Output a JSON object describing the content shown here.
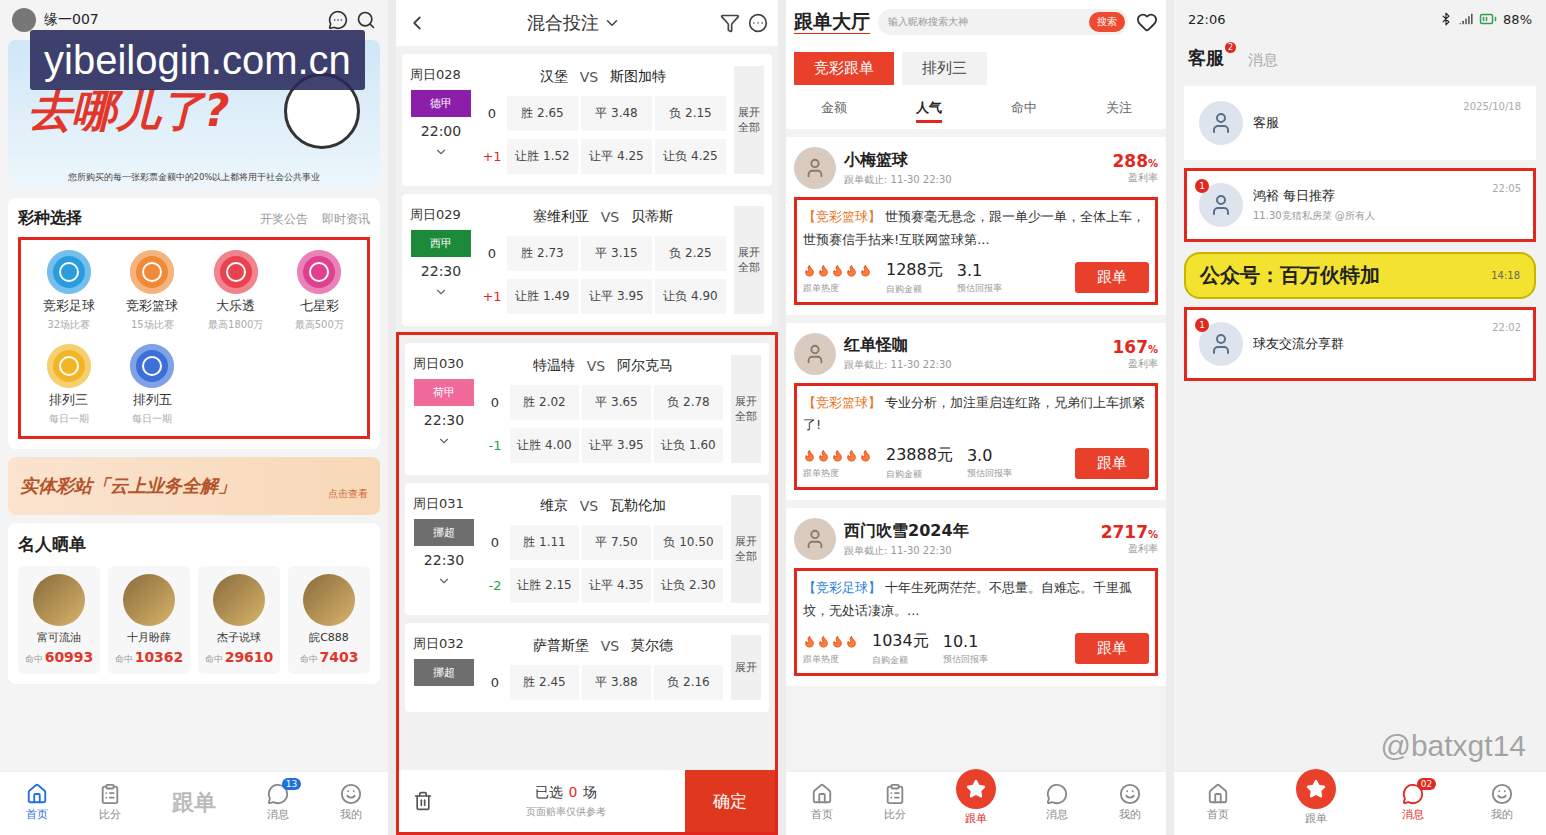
{
  "watermark": "yibeilogin.com.cn",
  "home": {
    "user": "缘一007",
    "banner": {
      "headline": "去哪儿了?",
      "note": "您所购买的每一张彩票金额中的20%以上都将用于社会公共事业"
    },
    "section": {
      "title": "彩种选择",
      "links": [
        "开奖公告",
        "即时资讯"
      ]
    },
    "games": {
      "highlighted": true,
      "items": [
        {
          "name": "竞彩足球",
          "sub": "32场比赛",
          "color": "#2a9de0"
        },
        {
          "name": "竞彩篮球",
          "sub": "15场比赛",
          "color": "#f08a3a"
        },
        {
          "name": "大乐透",
          "sub": "最高1800万",
          "color": "#e8434f"
        },
        {
          "name": "七星彩",
          "sub": "最高500万",
          "color": "#e0408f"
        },
        {
          "name": "排列三",
          "sub": "每日一期",
          "color": "#f2b526"
        },
        {
          "name": "排列五",
          "sub": "每日一期",
          "color": "#3c6fd8"
        }
      ]
    },
    "promo": {
      "title": "实体彩站「云上业务全解」",
      "link": "点击查看"
    },
    "stars": {
      "title": "名人晒单",
      "items": [
        {
          "name": "富可流油",
          "label": "命中",
          "value": "60993"
        },
        {
          "name": "十月盼薛",
          "label": "命中",
          "value": "10362"
        },
        {
          "name": "杰子说球",
          "label": "命中",
          "value": "29610"
        },
        {
          "name": "皖C888",
          "label": "命中",
          "value": "7403"
        }
      ]
    },
    "nav": [
      {
        "label": "首页",
        "selected": true,
        "kind": "icon",
        "badge": ""
      },
      {
        "label": "比分",
        "selected": false,
        "kind": "icon",
        "badge": ""
      },
      {
        "label": "跟单",
        "selected": false,
        "kind": "text",
        "badge": ""
      },
      {
        "label": "消息",
        "selected": false,
        "kind": "icon",
        "badge": "13"
      },
      {
        "label": "我的",
        "selected": false,
        "kind": "icon",
        "badge": ""
      }
    ]
  },
  "betting": {
    "title": "混合投注",
    "matches": [
      {
        "no": "周日028",
        "league": "德甲",
        "color": "#8b1fa9",
        "time": "22:00",
        "home": "汉堡",
        "vs": "VS",
        "away": "斯图加特",
        "base": "0",
        "odds": [
          "胜 2.65",
          "平 3.48",
          "负 2.15"
        ],
        "handicap": "+1",
        "hodds": [
          "让胜 1.52",
          "让平 4.25",
          "让负 4.25"
        ],
        "expand": "展开全部",
        "highlighted": false
      },
      {
        "no": "周日029",
        "league": "西甲",
        "color": "#1d8a3a",
        "time": "22:30",
        "home": "塞维利亚",
        "vs": "VS",
        "away": "贝蒂斯",
        "base": "0",
        "odds": [
          "胜 2.73",
          "平 3.15",
          "负 2.25"
        ],
        "handicap": "+1",
        "hodds": [
          "让胜 1.49",
          "让平 3.95",
          "让负 4.90"
        ],
        "expand": "展开全部",
        "highlighted": false
      },
      {
        "no": "周日030",
        "league": "荷甲",
        "color": "#f06a9a",
        "time": "22:30",
        "home": "特温特",
        "vs": "VS",
        "away": "阿尔克马",
        "base": "0",
        "odds": [
          "胜 2.02",
          "平 3.65",
          "负 2.78"
        ],
        "handicap": "-1",
        "hodds": [
          "让胜 4.00",
          "让平 3.95",
          "让负 1.60"
        ],
        "expand": "展开全部",
        "highlighted": true
      },
      {
        "no": "周日031",
        "league": "挪超",
        "color": "#6e6e6e",
        "time": "22:30",
        "home": "维京",
        "vs": "VS",
        "away": "瓦勒伦加",
        "base": "0",
        "odds": [
          "胜 1.11",
          "平 7.50",
          "负 10.50"
        ],
        "handicap": "-2",
        "hodds": [
          "让胜 2.15",
          "让平 4.35",
          "让负 2.30"
        ],
        "expand": "展开全部",
        "highlighted": true
      },
      {
        "no": "周日032",
        "league": "挪超",
        "color": "#6e6e6e",
        "time": "",
        "home": "萨普斯堡",
        "vs": "VS",
        "away": "莫尔德",
        "base": "0",
        "odds": [
          "胜 2.45",
          "平 3.88",
          "负 2.16"
        ],
        "handicap": "",
        "hodds": [],
        "expand": "展开",
        "highlighted": true
      }
    ],
    "footer": {
      "prefix": "已选",
      "count": "0",
      "suffix": "场",
      "note": "页面赔率仅供参考",
      "button": "确定",
      "highlighted": true
    }
  },
  "follow": {
    "title": "跟单大厅",
    "search": {
      "placeholder": "输入昵称搜索大神",
      "button": "搜索"
    },
    "tabs": [
      {
        "label": "竞彩跟单",
        "selected": true
      },
      {
        "label": "排列三",
        "selected": false
      }
    ],
    "sorts": [
      {
        "label": "金额",
        "selected": false
      },
      {
        "label": "人气",
        "selected": true
      },
      {
        "label": "命中",
        "selected": false
      },
      {
        "label": "关注",
        "selected": false
      }
    ],
    "cards": [
      {
        "name": "小梅篮球",
        "deadline": "跟单截止: 11-30 22:30",
        "rate": "288",
        "unit": "%",
        "rate_label": "盈利率",
        "tag": "【竞彩篮球】",
        "color": "#e8731c",
        "text": "世预赛毫无悬念，跟一单少一单，全体上车，世预赛信手拈来!互联网篮球第...",
        "stars": 5,
        "heat_label": "跟单热度",
        "amount": "1288元",
        "amount_label": "自购金额",
        "ret": "3.1",
        "ret_label": "预估回报率",
        "button": "跟单",
        "highlighted": true
      },
      {
        "name": "红单怪咖",
        "deadline": "跟单截止: 11-30 22:30",
        "rate": "167",
        "unit": "%",
        "rate_label": "盈利率",
        "tag": "【竞彩篮球】",
        "color": "#e8731c",
        "text": "专业分析，加注重启连红路，兄弟们上车抓紧了!",
        "stars": 5,
        "heat_label": "跟单热度",
        "amount": "23888元",
        "amount_label": "自购金额",
        "ret": "3.0",
        "ret_label": "预估回报率",
        "button": "跟单",
        "highlighted": true
      },
      {
        "name": "西门吹雪2024年",
        "deadline": "跟单截止: 11-30 22:30",
        "rate": "2717",
        "unit": "%",
        "rate_label": "盈利率",
        "tag": "【竞彩足球】",
        "color": "#2a7fd8",
        "text": "十年生死两茫茫。不思量。自难忘。千里孤坟，无处话凄凉。...",
        "stars": 4,
        "heat_label": "跟单热度",
        "amount": "1034元",
        "amount_label": "自购金额",
        "ret": "10.1",
        "ret_label": "预估回报率",
        "button": "跟单",
        "highlighted": true
      }
    ],
    "nav": [
      {
        "label": "首页",
        "selected": false,
        "kind": "icon",
        "badge": ""
      },
      {
        "label": "比分",
        "selected": false,
        "kind": "icon",
        "badge": ""
      },
      {
        "label": "跟单",
        "selected": true,
        "kind": "bubble",
        "badge": ""
      },
      {
        "label": "消息",
        "selected": false,
        "kind": "icon",
        "badge": ""
      },
      {
        "label": "我的",
        "selected": false,
        "kind": "icon",
        "badge": ""
      }
    ]
  },
  "chat": {
    "status": {
      "time": "22:06",
      "battery": "88%"
    },
    "tabs": [
      {
        "label": "客服",
        "selected": true,
        "badge": "2"
      },
      {
        "label": "消息",
        "selected": false,
        "badge": ""
      }
    ],
    "items": [
      {
        "kind": "chat",
        "name": "客服",
        "time": "2025/10/18",
        "preview": "",
        "badge": "",
        "highlighted": false
      },
      {
        "kind": "chat",
        "name": "鸿裕 每日推荐",
        "time": "22:05",
        "preview": "11.30竞猜私房菜 @所有人",
        "badge": "1",
        "highlighted": true
      },
      {
        "kind": "covered",
        "name": "公众号：百万伙特加",
        "time": "14:18",
        "preview": "",
        "badge": "",
        "highlighted": false
      },
      {
        "kind": "chat",
        "name": "球友交流分享群",
        "time": "22:02",
        "preview": "",
        "badge": "1",
        "highlighted": true
      }
    ],
    "nav": [
      {
        "label": "首页",
        "selected": false,
        "kind": "icon",
        "badge": ""
      },
      {
        "label": "跟单",
        "selected": false,
        "kind": "bubble",
        "badge": ""
      },
      {
        "label": "消息",
        "selected": true,
        "kind": "icon",
        "badge": "02"
      },
      {
        "label": "我的",
        "selected": false,
        "kind": "icon",
        "badge": ""
      }
    ],
    "watermark": "@batxgt14"
  }
}
